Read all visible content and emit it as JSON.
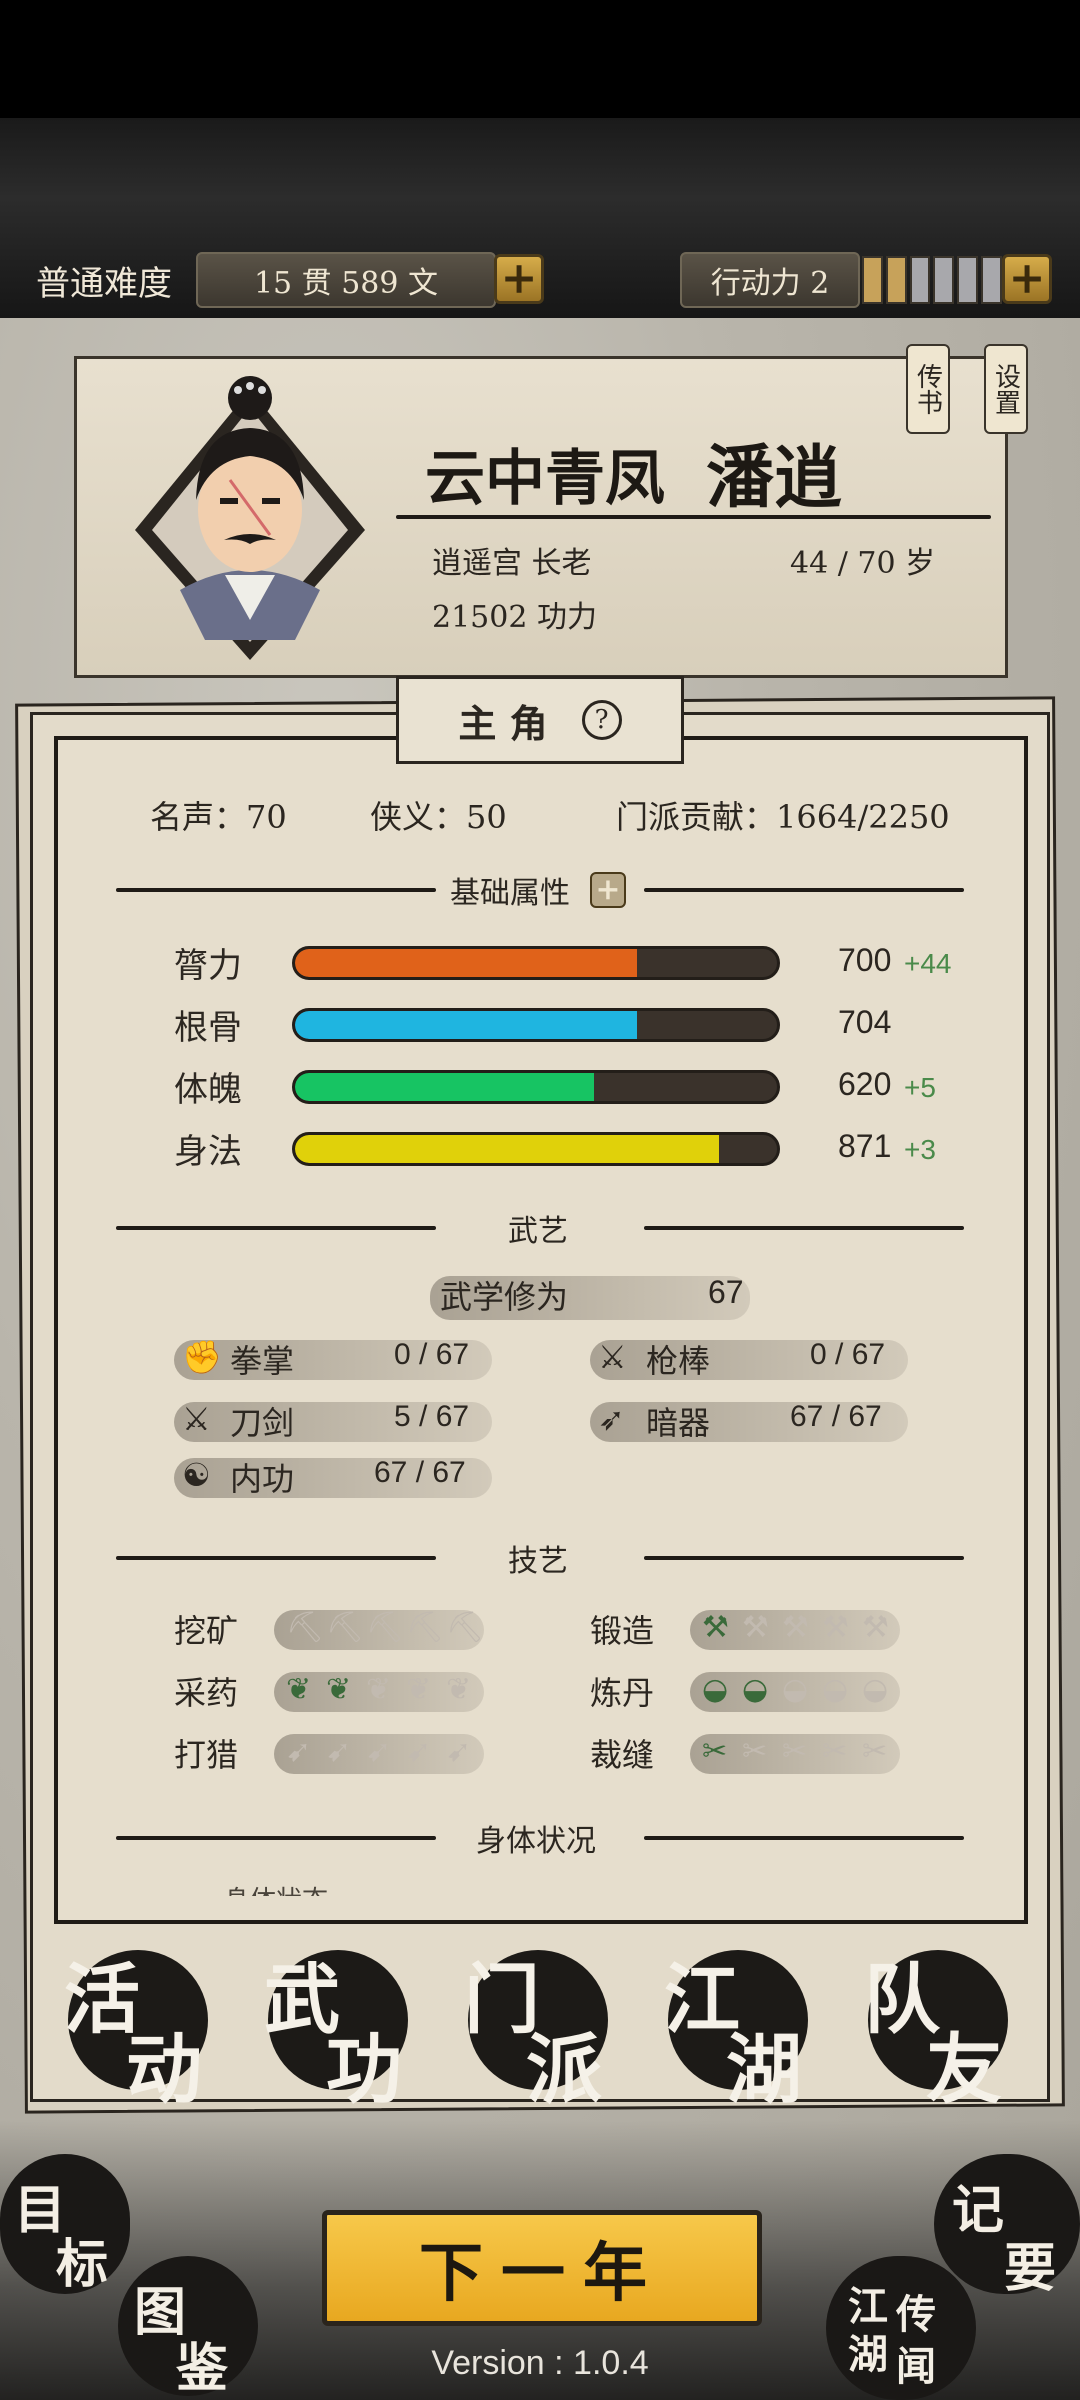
{
  "topbar": {
    "difficulty": "普通难度",
    "money": "15  贯  589  文",
    "action_label": "行动力 2",
    "action_filled": 2,
    "action_total": 6
  },
  "profile": {
    "title": "云中青凤",
    "name": "潘逍",
    "sect_rank": "逍遥宫 长老",
    "age": "44 / 70 岁",
    "power": "21502 功力",
    "tag_book": "传书",
    "tag_settings": "设置"
  },
  "panel": {
    "tab_title": "主  角",
    "help": "?",
    "fame": "名声：70",
    "chivalry": "侠义：50",
    "contribution": "门派贡献：1664/2250"
  },
  "attributes": {
    "title": "基础属性",
    "items": [
      {
        "label": "膂力",
        "value": "700",
        "bonus": "+44",
        "fill": 0.71,
        "color": "#e0621a"
      },
      {
        "label": "根骨",
        "value": "704",
        "bonus": "",
        "fill": 0.71,
        "color": "#1fb5e0"
      },
      {
        "label": "体魄",
        "value": "620",
        "bonus": "+5",
        "fill": 0.62,
        "color": "#17c463"
      },
      {
        "label": "身法",
        "value": "871",
        "bonus": "+3",
        "fill": 0.88,
        "color": "#e0d10a"
      }
    ]
  },
  "martial": {
    "title": "武艺",
    "cultivation_label": "武学修为",
    "cultivation_value": "67",
    "skills": [
      {
        "label": "拳掌",
        "value": "0 / 67",
        "icon": "fist-icon"
      },
      {
        "label": "枪棒",
        "value": "0 / 67",
        "icon": "spear-icon"
      },
      {
        "label": "刀剑",
        "value": "5 / 67",
        "icon": "sword-icon"
      },
      {
        "label": "暗器",
        "value": "67 / 67",
        "icon": "dart-icon"
      },
      {
        "label": "内功",
        "value": "67 / 67",
        "icon": "qi-icon"
      }
    ]
  },
  "crafts": {
    "title": "技艺",
    "items": [
      {
        "label": "挖矿",
        "level": 0,
        "icon": "pickaxe-icon"
      },
      {
        "label": "锻造",
        "level": 1,
        "icon": "anvil-icon"
      },
      {
        "label": "采药",
        "level": 2,
        "icon": "herb-icon"
      },
      {
        "label": "炼丹",
        "level": 2,
        "icon": "bowl-icon"
      },
      {
        "label": "打猎",
        "level": 0,
        "icon": "bow-icon"
      },
      {
        "label": "裁缝",
        "level": 1,
        "icon": "needle-icon"
      }
    ]
  },
  "body_status": {
    "title": "身体状况",
    "partial": "身体状态"
  },
  "bottom_nav": [
    "活动",
    "武功",
    "门派",
    "江湖",
    "队友"
  ],
  "corner_left_top": [
    "目",
    "标"
  ],
  "corner_left_bottom": [
    "图",
    "鉴"
  ],
  "corner_right_top": [
    "记",
    "要"
  ],
  "corner_right_bottom": [
    "江",
    "湖",
    "传",
    "闻"
  ],
  "next_year": "下一年",
  "version": "Version : 1.0.4"
}
